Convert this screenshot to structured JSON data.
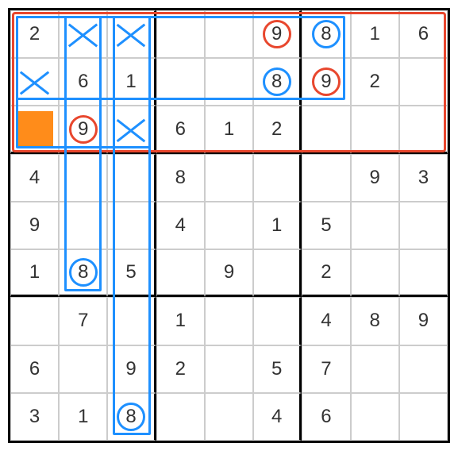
{
  "grid": {
    "size": 9,
    "cells": [
      [
        {
          "v": "2"
        },
        {
          "x": true
        },
        {
          "x": true
        },
        {
          "v": ""
        },
        {
          "v": ""
        },
        {
          "v": "9",
          "circle": "red"
        },
        {
          "v": "8",
          "circle": "blue"
        },
        {
          "v": "1"
        },
        {
          "v": "6"
        }
      ],
      [
        {
          "x": true
        },
        {
          "v": "6"
        },
        {
          "v": "1"
        },
        {
          "v": ""
        },
        {
          "v": ""
        },
        {
          "v": "8",
          "circle": "blue"
        },
        {
          "v": "9",
          "circle": "red"
        },
        {
          "v": "2"
        },
        {
          "v": ""
        }
      ],
      [
        {
          "fill": "orange"
        },
        {
          "v": "9",
          "circle": "red"
        },
        {
          "x": true
        },
        {
          "v": "6"
        },
        {
          "v": "1"
        },
        {
          "v": "2"
        },
        {
          "v": ""
        },
        {
          "v": ""
        },
        {
          "v": ""
        }
      ],
      [
        {
          "v": "4"
        },
        {
          "v": ""
        },
        {
          "v": ""
        },
        {
          "v": "8"
        },
        {
          "v": ""
        },
        {
          "v": ""
        },
        {
          "v": ""
        },
        {
          "v": "9"
        },
        {
          "v": "3"
        }
      ],
      [
        {
          "v": "9"
        },
        {
          "v": ""
        },
        {
          "v": ""
        },
        {
          "v": "4"
        },
        {
          "v": ""
        },
        {
          "v": "1"
        },
        {
          "v": "5"
        },
        {
          "v": ""
        },
        {
          "v": ""
        }
      ],
      [
        {
          "v": "1"
        },
        {
          "v": "8",
          "circle": "blue"
        },
        {
          "v": "5"
        },
        {
          "v": ""
        },
        {
          "v": "9"
        },
        {
          "v": ""
        },
        {
          "v": "2"
        },
        {
          "v": ""
        },
        {
          "v": ""
        }
      ],
      [
        {
          "v": ""
        },
        {
          "v": "7"
        },
        {
          "v": ""
        },
        {
          "v": "1"
        },
        {
          "v": ""
        },
        {
          "v": ""
        },
        {
          "v": "4"
        },
        {
          "v": "8"
        },
        {
          "v": "9"
        }
      ],
      [
        {
          "v": "6"
        },
        {
          "v": ""
        },
        {
          "v": "9"
        },
        {
          "v": "2"
        },
        {
          "v": ""
        },
        {
          "v": "5"
        },
        {
          "v": "7"
        },
        {
          "v": ""
        },
        {
          "v": ""
        }
      ],
      [
        {
          "v": "3"
        },
        {
          "v": "1"
        },
        {
          "v": "8",
          "circle": "blue"
        },
        {
          "v": ""
        },
        {
          "v": ""
        },
        {
          "v": "4"
        },
        {
          "v": "6"
        },
        {
          "v": ""
        },
        {
          "v": ""
        }
      ]
    ]
  },
  "highlights": [
    {
      "type": "red",
      "r": 0,
      "c": 0,
      "rs": 3,
      "cs": 9,
      "inset": 2
    },
    {
      "type": "blue",
      "r": 0,
      "c": 0,
      "rs": 2,
      "cs": 7,
      "inset": 7
    },
    {
      "type": "blue",
      "r": 0,
      "c": 0,
      "rs": 3,
      "cs": 3,
      "inset": 7
    },
    {
      "type": "blue",
      "r": 0,
      "c": 1,
      "rs": 6,
      "cs": 1,
      "inset": 7
    },
    {
      "type": "blue",
      "r": 0,
      "c": 2,
      "rs": 9,
      "cs": 1,
      "inset": 7
    }
  ],
  "colors": {
    "blue": "#1e90ff",
    "red": "#e8472e",
    "orange": "#ff8c1a"
  }
}
